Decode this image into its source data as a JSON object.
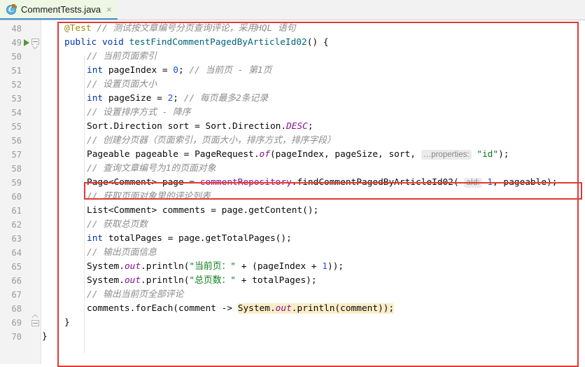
{
  "window": {
    "tab": {
      "label": "CommentTests.java",
      "icon": "java-test-class-icon",
      "close": "×"
    }
  },
  "editor": {
    "gutter": {
      "line_numbers": [
        48,
        49,
        50,
        51,
        52,
        53,
        54,
        55,
        56,
        57,
        58,
        59,
        60,
        61,
        62,
        63,
        64,
        65,
        66,
        67,
        68,
        69,
        70
      ],
      "run_marker_line": 49,
      "fold_marker_lines": [
        49,
        69
      ]
    },
    "annotations": {
      "outer_box_color": "#e03a35",
      "inner_box_color": "#e03a35",
      "inner_box_target_line": 59
    },
    "highlight_color": "#faedc8",
    "lines": {
      "l48": {
        "n": "48",
        "annotation": "@Test",
        "comment": "// 测试按文章编号分页查询评论，采用HQL 语句"
      },
      "l49": {
        "n": "49",
        "kw1": "public",
        "kw2": "void",
        "method": "testFindCommentPagedByArticleId02",
        "tail": "() {"
      },
      "l50": {
        "n": "50",
        "comment": "// 当前页面索引"
      },
      "l51": {
        "n": "51",
        "kw": "int",
        "name": " pageIndex = ",
        "value": "0",
        "semi": ";",
        "comment": "// 当前页 - 第1页"
      },
      "l52": {
        "n": "52",
        "comment": "// 设置页面大小"
      },
      "l53": {
        "n": "53",
        "kw": "int",
        "name": " pageSize = ",
        "value": "2",
        "semi": ";",
        "comment": "// 每页最多2条记录"
      },
      "l54": {
        "n": "54",
        "comment": "// 设置排序方式 - 降序"
      },
      "l55": {
        "n": "55",
        "pre": "Sort.Direction sort = Sort.Direction.",
        "static_field": "DESC",
        "semi": ";"
      },
      "l56": {
        "n": "56",
        "comment": "// 创建分页器（页面索引，页面大小，排序方式，排序字段）"
      },
      "l57": {
        "n": "57",
        "pre": "Pageable pageable = PageRequest.",
        "method": "of",
        "args": "(pageIndex, pageSize, sort, ",
        "hint": "…properties:",
        "str": "\"id\"",
        "tail": ");"
      },
      "l58": {
        "n": "58",
        "comment": "// 查询文章编号为1的页面对象"
      },
      "l59": {
        "n": "59",
        "pre": "Page<Comment> page = ",
        "field": "commentRepository",
        "dot": ".",
        "method": "findCommentPagedByArticleId02",
        "open": "( ",
        "hint": "aId:",
        "num": "1",
        "tail": ", pageable);"
      },
      "l60": {
        "n": "60",
        "comment": "// 获取页面对象里的评论列表"
      },
      "l61": {
        "n": "61",
        "text": "List<Comment> comments = page.getContent();"
      },
      "l62": {
        "n": "62",
        "comment": "// 获取总页数"
      },
      "l63": {
        "n": "63",
        "kw": "int",
        "text": " totalPages = page.getTotalPages();"
      },
      "l64": {
        "n": "64",
        "comment": "// 输出页面信息"
      },
      "l65": {
        "n": "65",
        "pre": "System.",
        "stat": "out",
        "mid": ".println(",
        "str": "\"当前页：\"",
        "mid2": " + (pageIndex + ",
        "num": "1",
        "tail": "));"
      },
      "l66": {
        "n": "66",
        "pre": "System.",
        "stat": "out",
        "mid": ".println(",
        "str": "\"总页数：\"",
        "tail": " + totalPages);"
      },
      "l67": {
        "n": "67",
        "comment": "// 输出当前页全部评论"
      },
      "l68": {
        "n": "68",
        "pre": "comments.forEach(comment -> ",
        "hl_pre": "System.",
        "hl_stat": "out",
        "hl_post": ".println(comment));"
      },
      "l69": {
        "n": "69",
        "text": "}"
      },
      "l70": {
        "n": "70",
        "text": "}"
      }
    }
  }
}
